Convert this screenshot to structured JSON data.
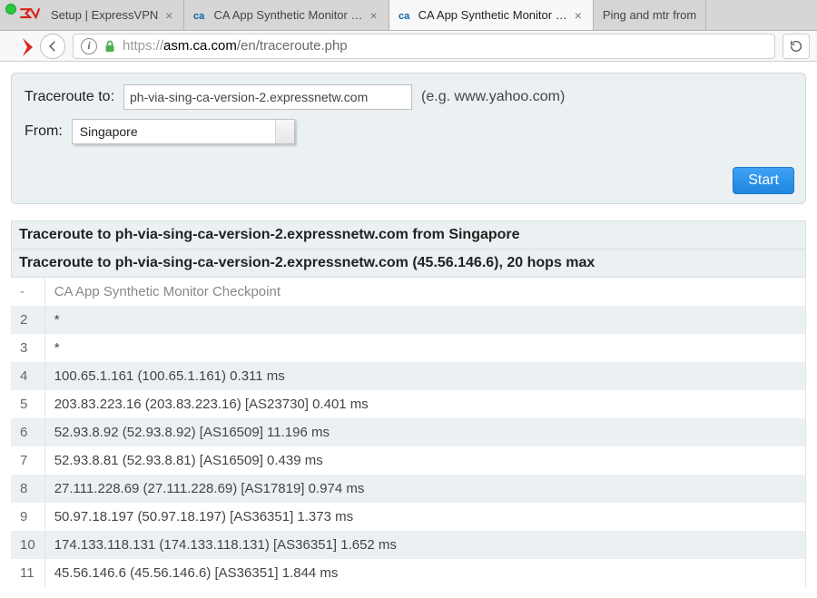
{
  "browser": {
    "tabs": [
      {
        "label": "Setup | ExpressVPN",
        "favicon": "express"
      },
      {
        "label": "CA App Synthetic Monitor …",
        "favicon": "ca"
      },
      {
        "label": "CA App Synthetic Monitor …",
        "favicon": "ca",
        "active": true
      },
      {
        "label": "Ping and mtr from",
        "favicon": "none"
      }
    ],
    "url": {
      "scheme": "https://",
      "host": "asm.ca.com",
      "path": "/en/traceroute.php"
    }
  },
  "form": {
    "traceroute_label": "Traceroute to:",
    "host_value": "ph-via-sing-ca-version-2.expressnetw.com",
    "hint": "(e.g. www.yahoo.com)",
    "from_label": "From:",
    "from_value": "Singapore",
    "start_label": "Start"
  },
  "results": {
    "heading": "Traceroute to ph-via-sing-ca-version-2.expressnetw.com from Singapore",
    "subheading": "Traceroute to ph-via-sing-ca-version-2.expressnetw.com (45.56.146.6), 20 hops max",
    "hops": [
      {
        "n": "-",
        "text": "CA App Synthetic Monitor Checkpoint"
      },
      {
        "n": "2",
        "text": "*"
      },
      {
        "n": "3",
        "text": "*"
      },
      {
        "n": "4",
        "text": "100.65.1.161 (100.65.1.161) 0.311 ms"
      },
      {
        "n": "5",
        "text": "203.83.223.16 (203.83.223.16) [AS23730] 0.401 ms"
      },
      {
        "n": "6",
        "text": "52.93.8.92 (52.93.8.92) [AS16509] 11.196 ms"
      },
      {
        "n": "7",
        "text": "52.93.8.81 (52.93.8.81) [AS16509] 0.439 ms"
      },
      {
        "n": "8",
        "text": "27.111.228.69 (27.111.228.69) [AS17819] 0.974 ms"
      },
      {
        "n": "9",
        "text": "50.97.18.197 (50.97.18.197) [AS36351] 1.373 ms"
      },
      {
        "n": "10",
        "text": "174.133.118.131 (174.133.118.131) [AS36351] 1.652 ms"
      },
      {
        "n": "11",
        "text": "45.56.146.6 (45.56.146.6) [AS36351] 1.844 ms"
      }
    ]
  }
}
